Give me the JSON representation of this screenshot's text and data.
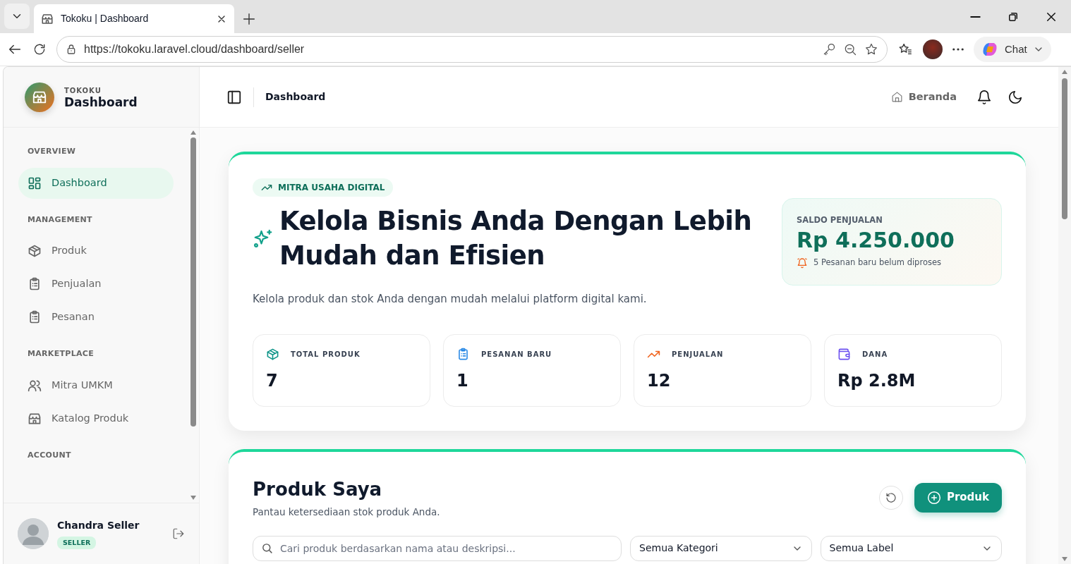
{
  "browser": {
    "tab_title": "Tokoku | Dashboard",
    "url": "https://tokoku.laravel.cloud/dashboard/seller",
    "chat_label": "Chat"
  },
  "sidebar": {
    "brand_overline": "TOKOKU",
    "brand_title": "Dashboard",
    "sections": [
      {
        "heading": "OVERVIEW",
        "items": [
          {
            "label": "Dashboard",
            "selected": true
          }
        ]
      },
      {
        "heading": "MANAGEMENT",
        "items": [
          {
            "label": "Produk",
            "selected": false
          },
          {
            "label": "Penjualan",
            "selected": false
          },
          {
            "label": "Pesanan",
            "selected": false
          }
        ]
      },
      {
        "heading": "MARKETPLACE",
        "items": [
          {
            "label": "Mitra UMKM",
            "selected": false
          },
          {
            "label": "Katalog Produk",
            "selected": false
          }
        ]
      },
      {
        "heading": "ACCOUNT"
      }
    ],
    "user": {
      "name": "Chandra Seller",
      "role": "SELLER"
    }
  },
  "header": {
    "title": "Dashboard",
    "home_link": "Beranda"
  },
  "hero": {
    "badge": "MITRA USAHA DIGITAL",
    "title": "Kelola Bisnis Anda Dengan Lebih Mudah dan Efisien",
    "subtitle": "Kelola produk dan stok Anda dengan mudah melalui platform digital kami.",
    "balance": {
      "label": "SALDO PENJUALAN",
      "amount": "Rp 4.250.000",
      "note": "5 Pesanan baru belum diproses"
    }
  },
  "stats": [
    {
      "label": "TOTAL PRODUK",
      "value": "7",
      "color": "#0d9488"
    },
    {
      "label": "PESANAN BARU",
      "value": "1",
      "color": "#2b8ae6"
    },
    {
      "label": "PENJUALAN",
      "value": "12",
      "color": "#f0621c"
    },
    {
      "label": "DANA",
      "value": "Rp 2.8M",
      "color": "#6b4ff0"
    }
  ],
  "products": {
    "title": "Produk Saya",
    "subtitle": "Pantau ketersediaan stok produk Anda.",
    "add_button": "Produk",
    "search": {
      "placeholder": "Cari produk berdasarkan nama atau deskripsi..."
    },
    "filters": [
      {
        "value": "Semua Kategori"
      },
      {
        "value": "Semua Label"
      }
    ]
  }
}
